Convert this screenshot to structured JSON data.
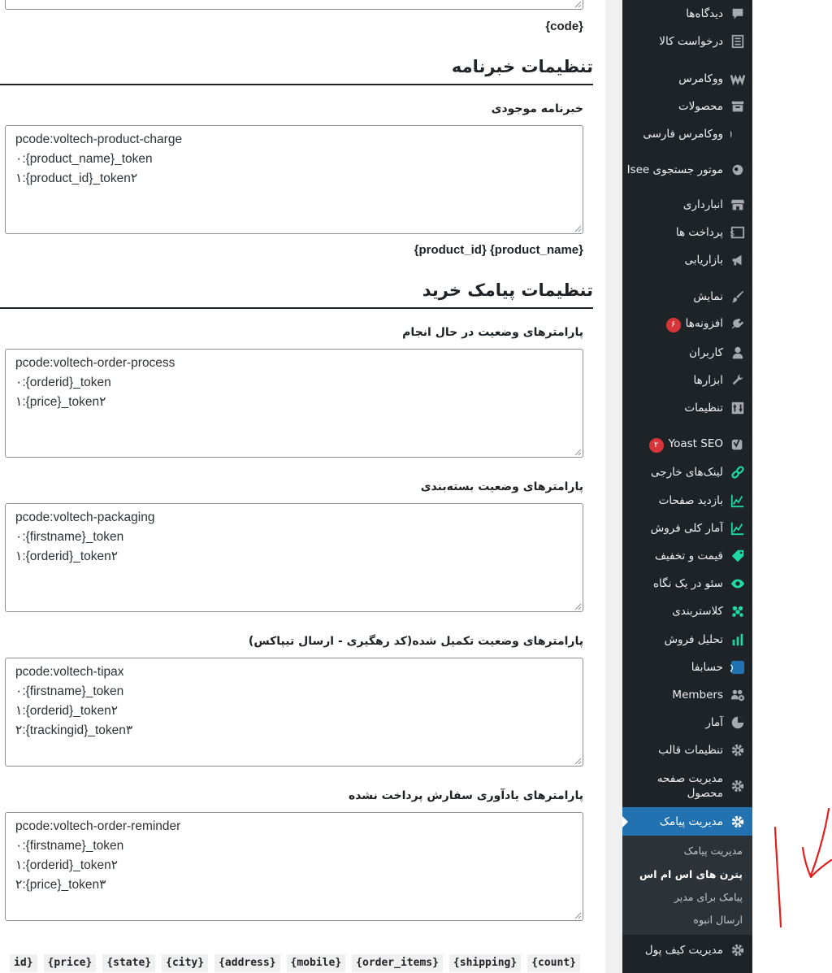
{
  "top_hint": "{code}",
  "newsletter": {
    "heading": "تنظیمات خبرنامه",
    "field_label": "خبرنامه موجودی",
    "lines": [
      "pcode:voltech-product-charge",
      "۰:{product_name}_token",
      "۱:{product_id}_token۲"
    ],
    "hint": "{product_id} {product_name}"
  },
  "purchase": {
    "heading": "تنظیمات پیامک خرید",
    "fields": [
      {
        "label": "پارامترهای وضعیت در حال انجام",
        "lines": [
          "pcode:voltech-order-process",
          "۰:{orderid}_token",
          "۱:{price}_token۲"
        ]
      },
      {
        "label": "پارامترهای وضعیت بسته‌بندی",
        "lines": [
          "pcode:voltech-packaging",
          "۰:{firstname}_token",
          "۱:{orderid}_token۲"
        ]
      },
      {
        "label": "پارامترهای وضعیت تکمیل شده(کد رهگیری - ارسال تیپاکس)",
        "lines": [
          "pcode:voltech-tipax",
          "۰:{firstname}_token",
          "۱:{orderid}_token۲",
          "۲:{trackingid}_token۳"
        ]
      },
      {
        "label": "پارامترهای یادآوری سفارش پرداخت نشده",
        "lines": [
          "pcode:voltech-order-reminder",
          "۰:{firstname}_token",
          "۱:{orderid}_token۲",
          "۲:{price}_token۳"
        ]
      }
    ]
  },
  "tokens": [
    "{count}",
    "{shipping}",
    "{order_items}",
    "{mobile}",
    "{address}",
    "{city}",
    "{state}",
    "{price}",
    "id}"
  ],
  "sidebar": {
    "items": [
      {
        "label": "دیدگاه‌ها",
        "icon": "comment-icon"
      },
      {
        "label": "درخواست کالا",
        "icon": "list-icon"
      },
      {
        "label": "ووکامرس",
        "icon": "woocommerce-icon"
      },
      {
        "label": "محصولات",
        "icon": "archive-icon"
      },
      {
        "label": "ووکامرس فارسی",
        "icon": "quote-icon"
      },
      {
        "label": "موتور جستجوی Isee",
        "icon": "eye-search-icon"
      },
      {
        "label": "انبارداری",
        "icon": "store-icon"
      },
      {
        "label": "پرداخت ها",
        "icon": "dollar-icon"
      },
      {
        "label": "بازاریابی",
        "icon": "megaphone-icon"
      },
      {
        "label": "نمایش",
        "icon": "brush-icon"
      },
      {
        "label": "افزونه‌ها",
        "icon": "plugin-icon",
        "badge": "۶"
      },
      {
        "label": "کاربران",
        "icon": "user-icon"
      },
      {
        "label": "ابزارها",
        "icon": "wrench-icon"
      },
      {
        "label": "تنظیمات",
        "icon": "settings-icon"
      },
      {
        "label": "Yoast SEO",
        "icon": "yoast-icon",
        "badge": "۲"
      },
      {
        "label": "لینک‌های خارجی",
        "icon": "link-icon"
      },
      {
        "label": "بازدید صفحات",
        "icon": "chart-line-icon"
      },
      {
        "label": "آمار کلی فروش",
        "icon": "chart-line-icon"
      },
      {
        "label": "قیمت و تخفیف",
        "icon": "tag-icon"
      },
      {
        "label": "سئو در یک نگاه",
        "icon": "eye-icon"
      },
      {
        "label": "کلاستربندی",
        "icon": "groups-icon"
      },
      {
        "label": "تحلیل فروش",
        "icon": "bar-chart-icon"
      },
      {
        "label": "حسابفا",
        "icon": "hesabfa-icon"
      },
      {
        "label": "Members",
        "icon": "members-icon"
      },
      {
        "label": "آمار",
        "icon": "pie-chart-icon"
      },
      {
        "label": "تنظیمات قالب",
        "icon": "gear-icon"
      },
      {
        "label": "مدیریت صفحه محصول",
        "icon": "gear-icon"
      },
      {
        "label": "مدیریت پیامک",
        "icon": "gear-icon"
      },
      {
        "label": "مدیریت کیف پول",
        "icon": "gear-icon"
      }
    ],
    "submenu": [
      "مدیریت پیامک",
      "پترن های اس ام اس",
      "پیامک برای مدیر",
      "ارسال انبوه"
    ]
  },
  "colors": {
    "sidebar_bg": "#1d2327",
    "submenu_bg": "#2c3338",
    "current_bg": "#2271b1",
    "badge": "#d63638",
    "icon_accent": "#1ed9a4",
    "annotation": "#e02020"
  }
}
